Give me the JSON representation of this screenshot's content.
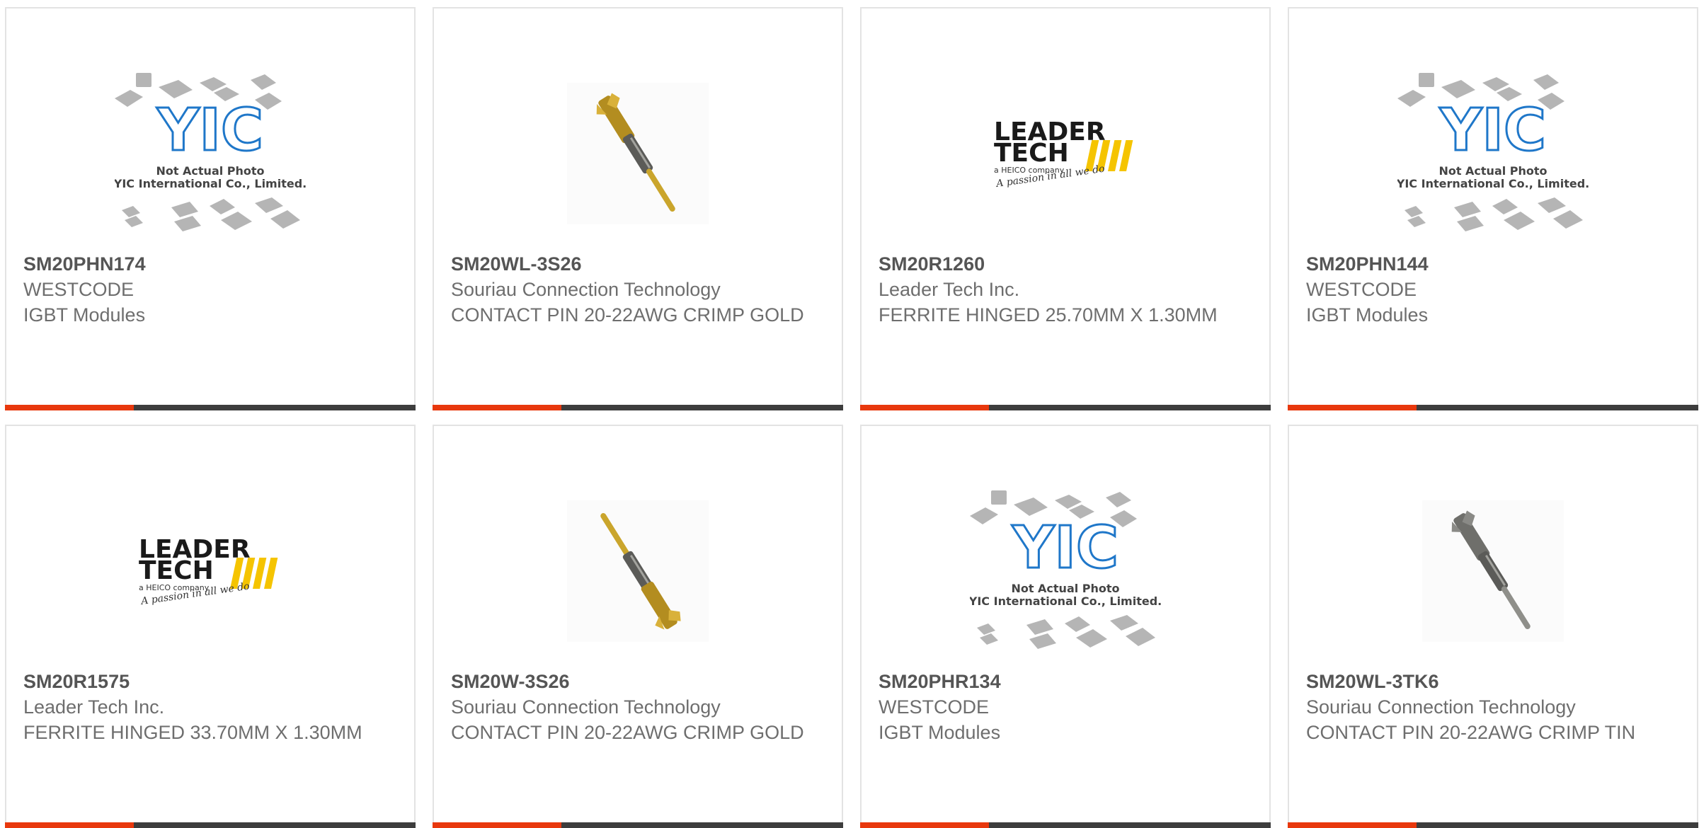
{
  "products": [
    {
      "part": "SM20PHN174",
      "manufacturer": "WESTCODE",
      "description": "IGBT Modules",
      "image": "yic-placeholder",
      "placeholder_line1": "Not Actual Photo",
      "placeholder_line2": "YIC International Co., Limited.",
      "placeholder_logo": "YIC"
    },
    {
      "part": "SM20WL-3S26",
      "manufacturer": "Souriau Connection Technology",
      "description": "CONTACT PIN 20-22AWG CRIMP GOLD",
      "image": "contact-pin-gold"
    },
    {
      "part": "SM20R1260",
      "manufacturer": "Leader Tech Inc.",
      "description": "FERRITE HINGED 25.70MM X 1.30MM",
      "image": "leadertech-logo",
      "logo_line1": "LEADER",
      "logo_line2": "TECH",
      "logo_sub": "a HEICO company",
      "logo_tagline": "A passion in all we do"
    },
    {
      "part": "SM20PHN144",
      "manufacturer": "WESTCODE",
      "description": "IGBT Modules",
      "image": "yic-placeholder",
      "placeholder_line1": "Not Actual Photo",
      "placeholder_line2": "YIC International Co., Limited.",
      "placeholder_logo": "YIC"
    },
    {
      "part": "SM20R1575",
      "manufacturer": "Leader Tech Inc.",
      "description": "FERRITE HINGED 33.70MM X 1.30MM",
      "image": "leadertech-logo",
      "logo_line1": "LEADER",
      "logo_line2": "TECH",
      "logo_sub": "a HEICO company",
      "logo_tagline": "A passion in all we do"
    },
    {
      "part": "SM20W-3S26",
      "manufacturer": "Souriau Connection Technology",
      "description": "CONTACT PIN 20-22AWG CRIMP GOLD",
      "image": "contact-pin-gold-reversed"
    },
    {
      "part": "SM20PHR134",
      "manufacturer": "WESTCODE",
      "description": "IGBT Modules",
      "image": "yic-placeholder",
      "placeholder_line1": "Not Actual Photo",
      "placeholder_line2": "YIC International Co., Limited.",
      "placeholder_logo": "YIC"
    },
    {
      "part": "SM20WL-3TK6",
      "manufacturer": "Souriau Connection Technology",
      "description": "CONTACT PIN 20-22AWG CRIMP TIN",
      "image": "contact-pin-tin"
    }
  ],
  "colors": {
    "accent": "#e8380d",
    "bar": "#3d3d3d",
    "border": "#e3e3e3",
    "text": "#6e6e6e",
    "part": "#555555",
    "yic_blue": "#1f77c9",
    "gold": "#c9a227",
    "tin": "#8a8a86",
    "leader_yellow": "#f5c400"
  }
}
